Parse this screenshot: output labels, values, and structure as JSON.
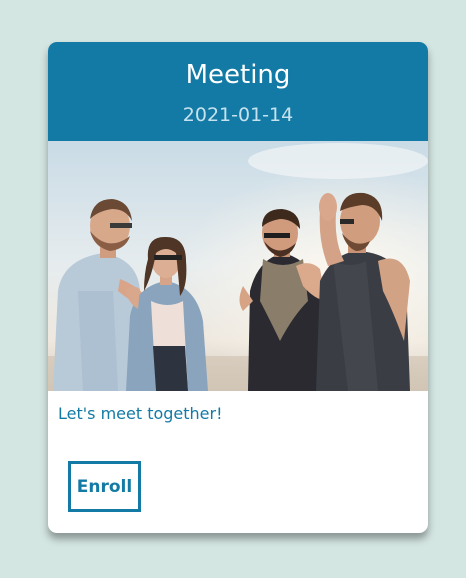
{
  "card": {
    "title": "Meeting",
    "date": "2021-01-14",
    "description": "Let's meet together!",
    "enroll_label": "Enroll",
    "image_alt": "group-of-friends-photo"
  },
  "colors": {
    "background": "#d4e6e2",
    "accent": "#137aa5",
    "card": "#ffffff"
  }
}
